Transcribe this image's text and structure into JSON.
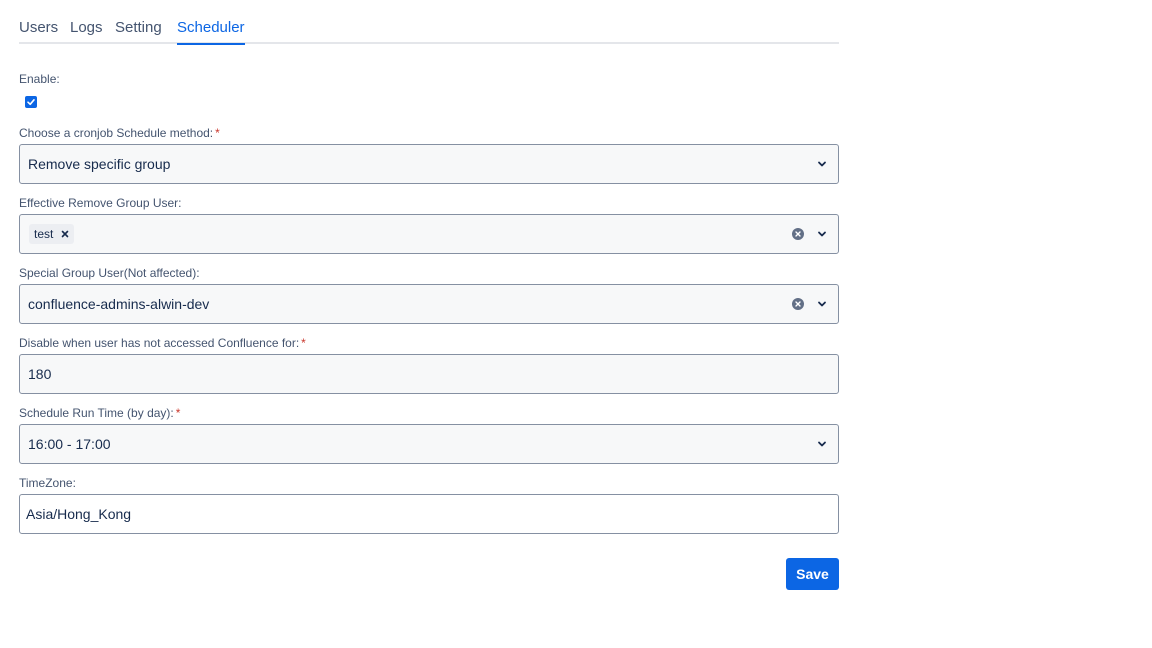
{
  "tabs": [
    {
      "label": "Users"
    },
    {
      "label": "Logs"
    },
    {
      "label": "Setting"
    },
    {
      "label": "Scheduler"
    }
  ],
  "active_tab": "Scheduler",
  "form": {
    "enable": {
      "label": "Enable:",
      "checked": true
    },
    "schedule_method": {
      "label": "Choose a cronjob Schedule method:",
      "required_mark": "*",
      "value": "Remove specific group"
    },
    "remove_group_user": {
      "label": "Effective Remove Group User:",
      "tags": [
        "test"
      ]
    },
    "special_group_user": {
      "label": "Special Group User(Not affected):",
      "value": "confluence-admins-alwin-dev"
    },
    "inactive_days": {
      "label": "Disable when user has not accessed Confluence for:",
      "required_mark": "*",
      "value": "180"
    },
    "run_time": {
      "label": "Schedule Run Time (by day):",
      "required_mark": "*",
      "value": "16:00 - 17:00"
    },
    "timezone": {
      "label": "TimeZone:",
      "value": "Asia/Hong_Kong"
    }
  },
  "save_label": "Save",
  "icons": {
    "chevron": "chevron-down-icon",
    "clear": "clear-icon",
    "remove": "close-icon",
    "check": "check-icon"
  },
  "colors": {
    "accent": "#0c66e4",
    "required": "#c9372c",
    "text": "#172b4d",
    "subtle_text": "#44546f",
    "border": "#8590a2"
  }
}
